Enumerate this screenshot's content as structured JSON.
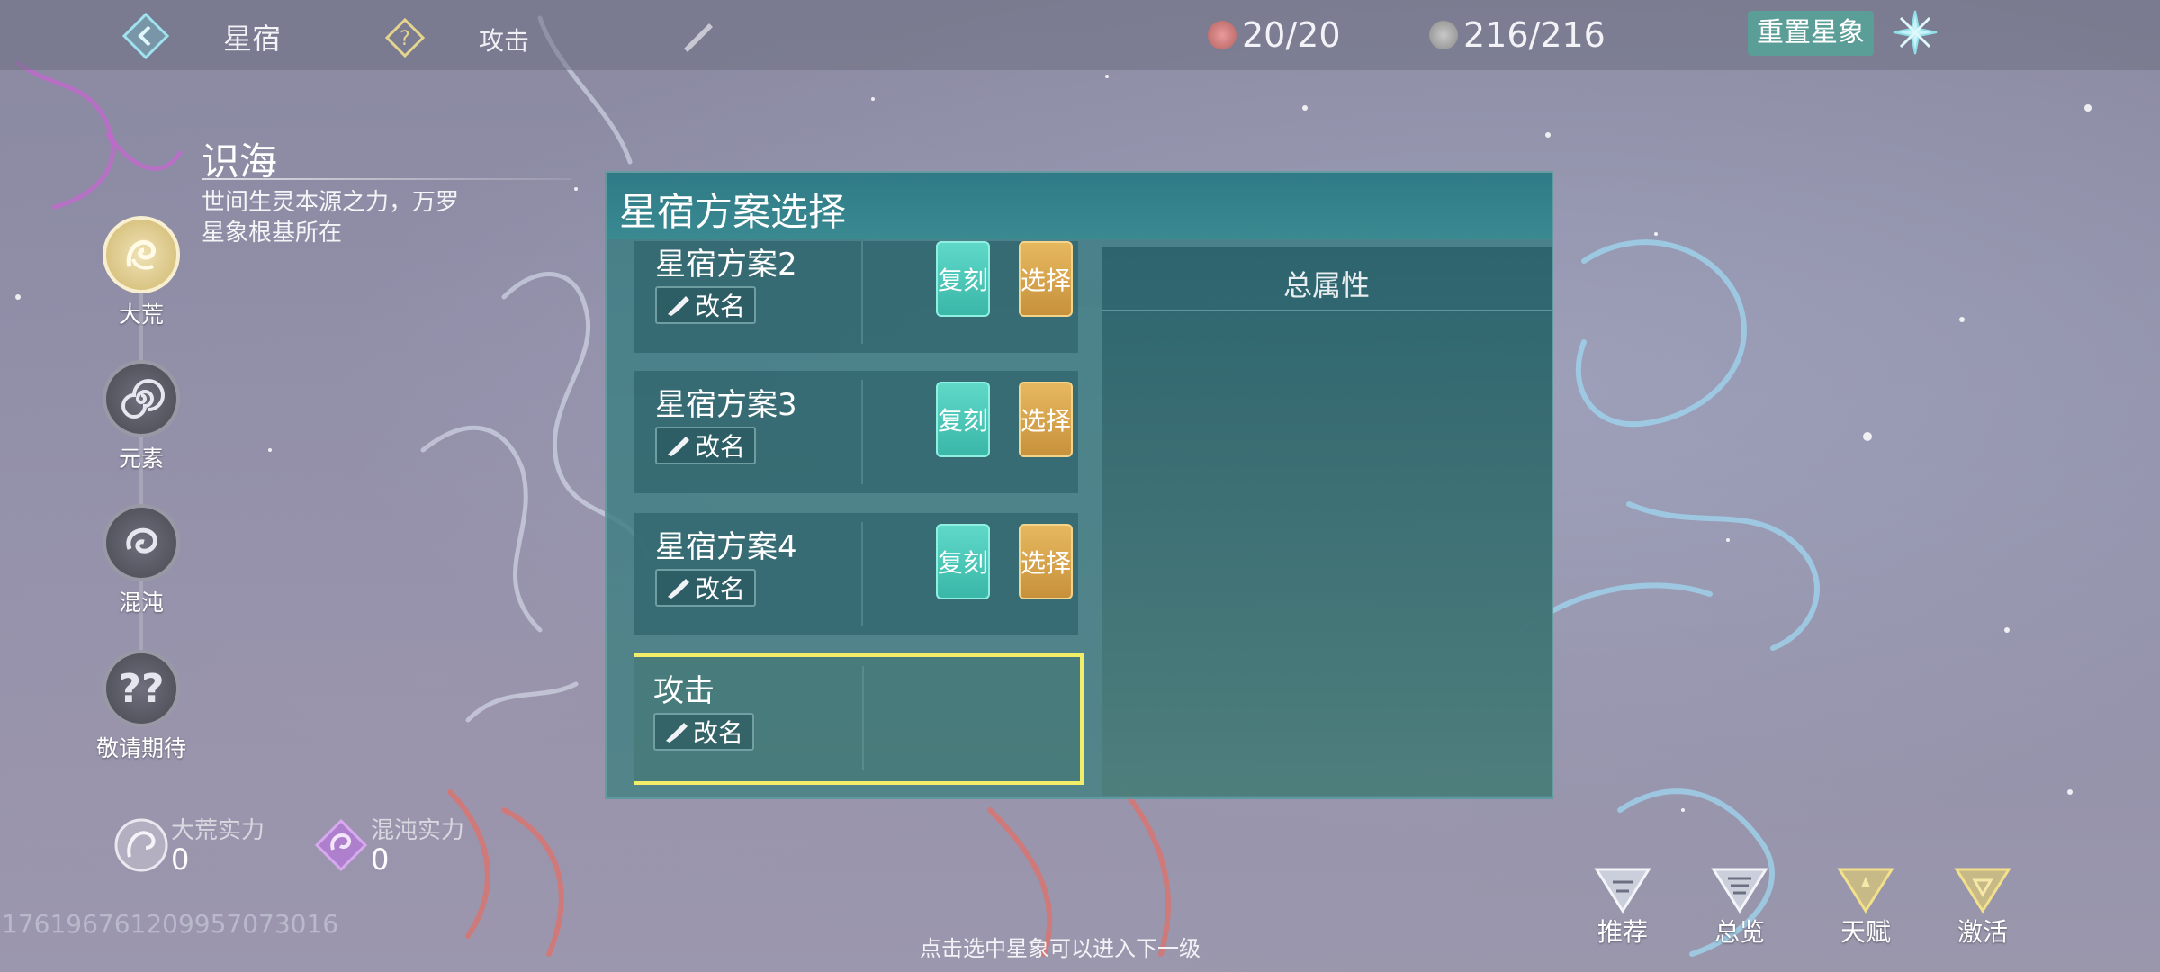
{
  "topbar": {
    "title": "星宿",
    "scheme_name": "攻击",
    "resource1": "20/20",
    "resource2": "216/216",
    "reset_label": "重置星象"
  },
  "info": {
    "title": "识海",
    "description": "世间生灵本源之力，万罗星象根基所在"
  },
  "nav": [
    {
      "label": "大荒"
    },
    {
      "label": "元素"
    },
    {
      "label": "混沌"
    },
    {
      "label": "敬请期待",
      "glyph": "??"
    }
  ],
  "power": [
    {
      "label": "大荒实力",
      "value": "0"
    },
    {
      "label": "混沌实力",
      "value": "0"
    }
  ],
  "uid": "1761967612099570730​16",
  "hint": "点击选中星象可以进入下一级",
  "panel": {
    "title": "星宿方案选择",
    "rows": [
      {
        "title": "星宿方案2",
        "rename": "改名",
        "copy": "复刻",
        "choose": "选择"
      },
      {
        "title": "星宿方案3",
        "rename": "改名",
        "copy": "复刻",
        "choose": "选择"
      },
      {
        "title": "星宿方案4",
        "rename": "改名",
        "copy": "复刻",
        "choose": "选择"
      },
      {
        "title": "攻击",
        "rename": "改名"
      }
    ],
    "attr_title": "总属性"
  },
  "bottom_buttons": [
    {
      "label": "推荐"
    },
    {
      "label": "总览"
    },
    {
      "label": "天赋"
    },
    {
      "label": "激活"
    }
  ],
  "colors": {
    "panel": "#3e7d84",
    "copy_button": "#3ab7a8",
    "choose_button": "#c8913c",
    "selected_border": "#f3ee6a",
    "reset_button": "#5b9e97"
  }
}
